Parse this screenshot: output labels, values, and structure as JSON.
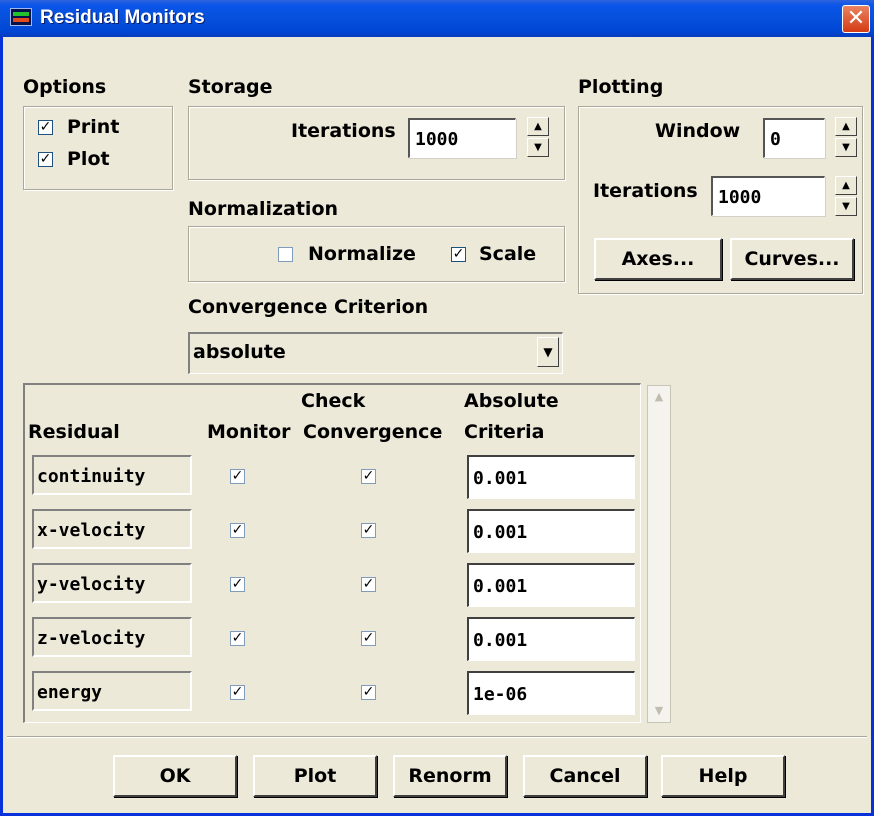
{
  "window": {
    "title": "Residual Monitors",
    "close_glyph": "✕"
  },
  "options": {
    "label": "Options",
    "print": {
      "label": "Print",
      "checked": true
    },
    "plot": {
      "label": "Plot",
      "checked": true
    }
  },
  "storage": {
    "label": "Storage",
    "iterations_label": "Iterations",
    "iterations_value": "1000"
  },
  "normalization": {
    "label": "Normalization",
    "normalize": {
      "label": "Normalize",
      "checked": false
    },
    "scale": {
      "label": "Scale",
      "checked": true
    }
  },
  "plotting": {
    "label": "Plotting",
    "window_label": "Window",
    "window_value": "0",
    "iterations_label": "Iterations",
    "iterations_value": "1000",
    "axes_button": "Axes...",
    "curves_button": "Curves..."
  },
  "convergence": {
    "label": "Convergence Criterion",
    "selected": "absolute"
  },
  "table": {
    "headers": {
      "residual": "Residual",
      "monitor": "Monitor",
      "check_line1": "Check",
      "check_line2": "Convergence",
      "criteria_line1": "Absolute",
      "criteria_line2": "Criteria"
    },
    "rows": [
      {
        "name": "continuity",
        "monitor": true,
        "check": true,
        "criteria": "0.001"
      },
      {
        "name": "x-velocity",
        "monitor": true,
        "check": true,
        "criteria": "0.001"
      },
      {
        "name": "y-velocity",
        "monitor": true,
        "check": true,
        "criteria": "0.001"
      },
      {
        "name": "z-velocity",
        "monitor": true,
        "check": true,
        "criteria": "0.001"
      },
      {
        "name": "energy",
        "monitor": true,
        "check": true,
        "criteria": "1e-06"
      }
    ]
  },
  "buttons": {
    "ok": "OK",
    "plot": "Plot",
    "renorm": "Renorm",
    "cancel": "Cancel",
    "help": "Help"
  },
  "glyphs": {
    "check": "✓",
    "spin_up": "▲",
    "spin_down": "▼",
    "dropdown": "▼",
    "scroll_up": "▲",
    "scroll_down": "▼"
  },
  "colors": {
    "titlebar": "#0054e3",
    "dialog": "#ece9d8",
    "close": "#e24c1c"
  },
  "icons": {
    "app": "fluent-app-icon",
    "close": "close-icon"
  }
}
